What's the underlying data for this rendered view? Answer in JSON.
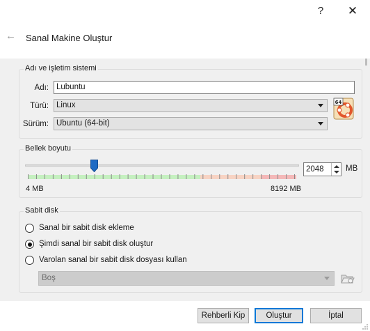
{
  "titlebar": {
    "help": "?",
    "close": "✕"
  },
  "wizard": {
    "back": "←",
    "title": "Sanal Makine Oluştur"
  },
  "os_section": {
    "title": "Adı ve işletim sistemi",
    "name_label": "Adı:",
    "name_value": "Lubuntu",
    "type_label": "Türü:",
    "type_value": "Linux",
    "version_label": "Sürüm:",
    "version_value": "Ubuntu (64-bit)",
    "os_icon_badge": "64"
  },
  "memory_section": {
    "title": "Bellek boyutu",
    "value": "2048",
    "unit": "MB",
    "min_label": "4 MB",
    "max_label": "8192 MB",
    "min_mb": 4,
    "max_mb": 8192,
    "current_mb": 2048
  },
  "disk_section": {
    "title": "Sabit disk",
    "options": [
      {
        "label": "Sanal bir sabit disk ekleme",
        "selected": false
      },
      {
        "label": "Şimdi sanal bir sabit disk oluştur",
        "selected": true
      },
      {
        "label": "Varolan sanal bir sabit disk dosyası kullan",
        "selected": false
      }
    ],
    "existing_disk_value": "Boş"
  },
  "buttons": {
    "guided": "Rehberli Kip",
    "create": "Oluştur",
    "cancel": "İptal"
  },
  "colors": {
    "green_zone": "#c5f0c0",
    "orange_zone": "#f7d3c3",
    "red_zone": "#f4b8b8",
    "thumb": "#1f6bc4",
    "accent": "#0078d7"
  }
}
